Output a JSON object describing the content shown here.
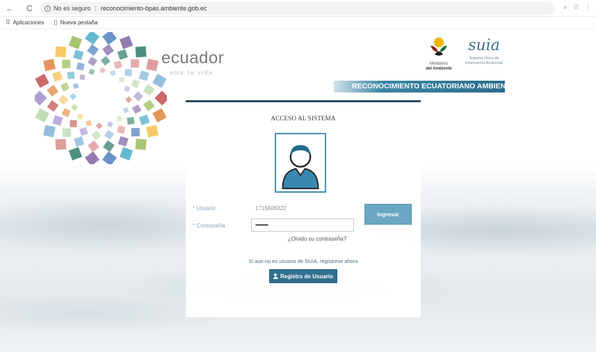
{
  "browser": {
    "security_label": "No es seguro",
    "url": "reconocimiento-bpas.ambiente.gob.ec",
    "back_icon": "back-arrow-icon",
    "reload_icon": "reload-icon",
    "bookmarks": [
      {
        "label": "Aplicaciones",
        "icon": "apps-grid-icon"
      },
      {
        "label": "Nueva pestaña",
        "icon": "page-icon"
      }
    ]
  },
  "header": {
    "brand": "ecuador",
    "brand_sub": "ama la vida",
    "ministry_line1": "Ministerio",
    "ministry_line2": "del Ambiente",
    "suia_word": "suia",
    "suia_line1": "Sistema Único de",
    "suia_line2": "Información Ambiental",
    "banner": "RECONOCIMIENTO ECUATORIANO AMBIENTAL"
  },
  "login": {
    "title": "ACCESO AL SISTEMA",
    "user_label": "* Usuario",
    "user_value": "1715606322",
    "password_label": "* Contraseña",
    "password_value": "••••••••••",
    "submit_label": "Ingresar",
    "forgot_label": "¿Olvido su contraseña?",
    "register_text": "Si aun no es usuario de SUIA, regístrese ahora",
    "register_button": "Registro de Usuario",
    "avatar_icon": "user-avatar-icon"
  },
  "colors": {
    "accent": "#31708f",
    "banner": "#2c6d8a",
    "button": "#6aa7c2"
  }
}
